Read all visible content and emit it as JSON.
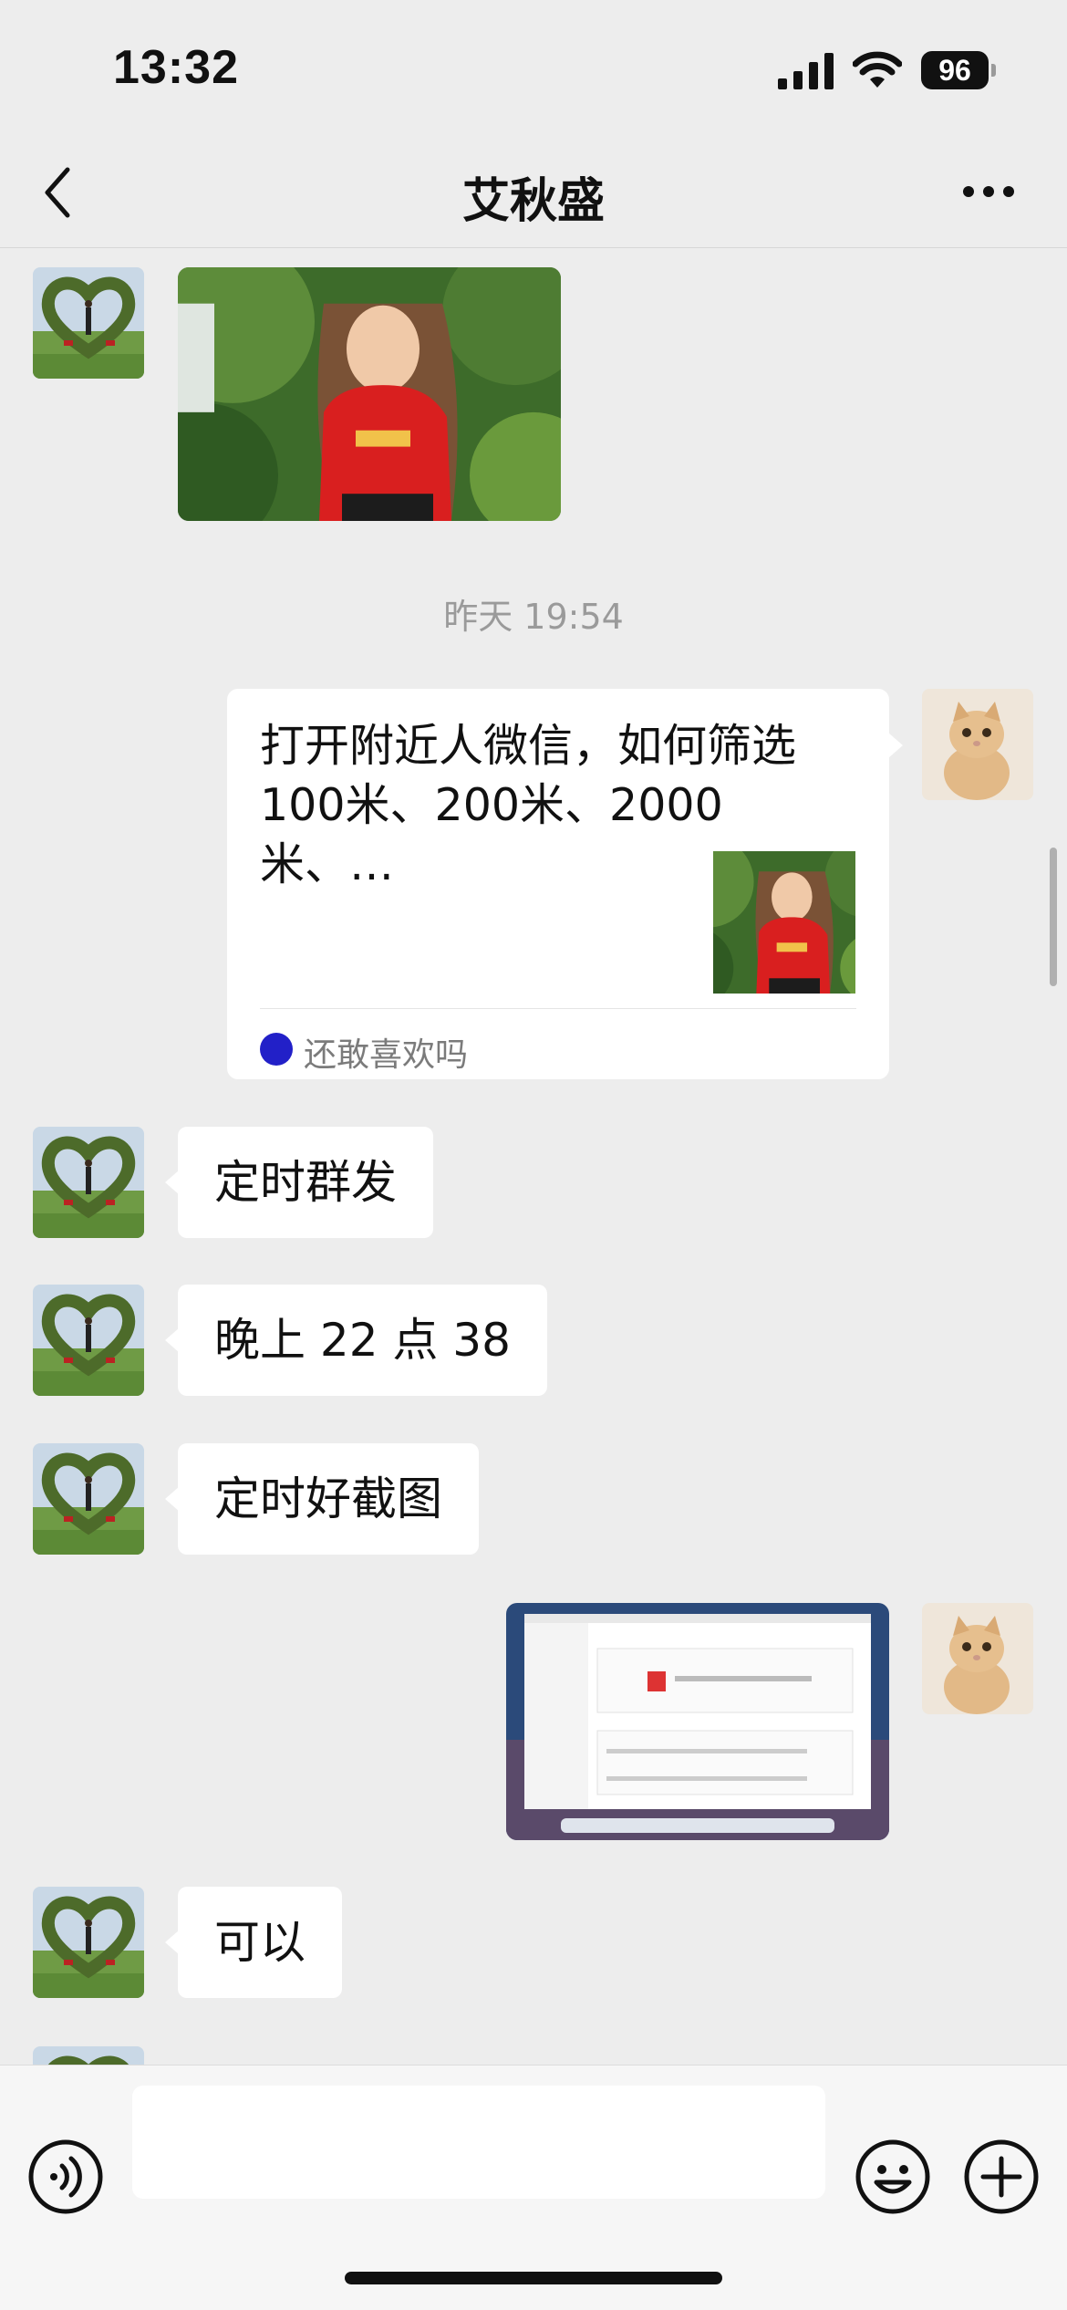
{
  "status_bar": {
    "time": "13:32",
    "battery": "96"
  },
  "nav": {
    "title": "艾秋盛",
    "back_icon": "chevron-left-icon",
    "more_icon": "ellipsis-icon"
  },
  "messages": {
    "timestamp": "昨天 19:54",
    "link_card": {
      "title": "打开附近人微信，如何筛选100米、200米、2000米、…",
      "source": "还敢喜欢吗"
    },
    "m1": "定时群发",
    "m2": "晚上 22 点 38",
    "m3": "定时好截图",
    "m4": "可以"
  },
  "input_bar": {
    "voice_icon": "voice-icon",
    "emoji_icon": "emoji-icon",
    "plus_icon": "plus-icon"
  }
}
